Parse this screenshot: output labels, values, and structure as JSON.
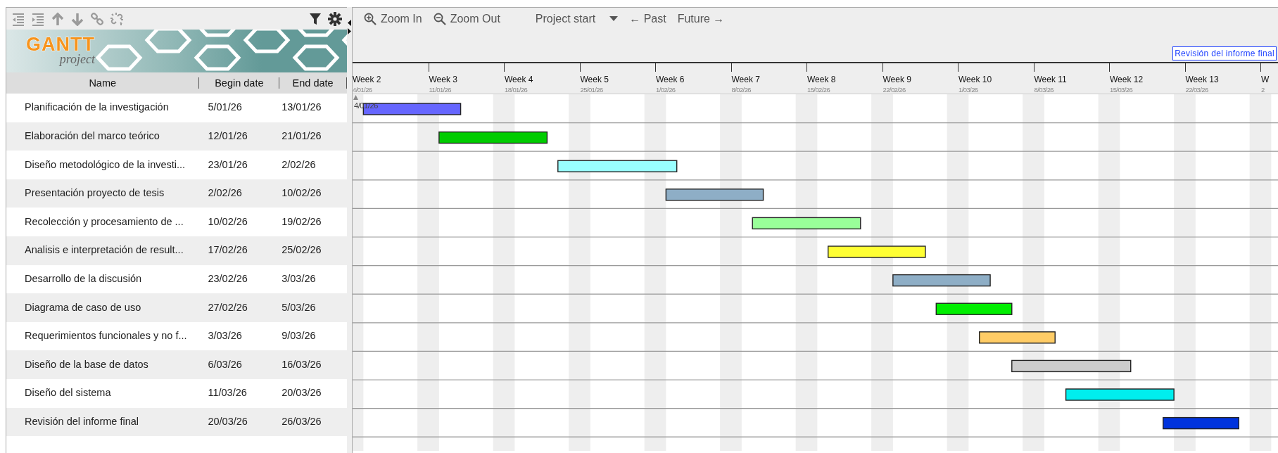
{
  "toolbar": {
    "buttons": [
      {
        "kind": "outdent",
        "disabled": true
      },
      {
        "kind": "indent",
        "disabled": true
      },
      {
        "kind": "up",
        "disabled": true
      },
      {
        "kind": "down",
        "disabled": true
      },
      {
        "kind": "link",
        "disabled": true
      },
      {
        "kind": "unlink",
        "disabled": true
      },
      {
        "kind": "filter",
        "disabled": false
      },
      {
        "kind": "settings",
        "disabled": false
      }
    ]
  },
  "logo": {
    "wordmark": "GANTT",
    "tagline": "project"
  },
  "columns": [
    "Name",
    "Begin date",
    "End date"
  ],
  "tasks": [
    {
      "name": "Planificación de la investigación",
      "begin": "5/01/26",
      "end": "13/01/26",
      "color": "#6666ff"
    },
    {
      "name": "Elaboración del marco teórico",
      "begin": "12/01/26",
      "end": "21/01/26",
      "color": "#00cc00"
    },
    {
      "name": "Diseño metodológico de la investi...",
      "begin": "23/01/26",
      "end": "2/02/26",
      "color": "#99ffff"
    },
    {
      "name": "Presentación proyecto de tesis",
      "begin": "2/02/26",
      "end": "10/02/26",
      "color": "#8eaec6"
    },
    {
      "name": "Recolección y procesamiento de ...",
      "begin": "10/02/26",
      "end": "19/02/26",
      "color": "#99ff99"
    },
    {
      "name": "Analisis e interpretación de result...",
      "begin": "17/02/26",
      "end": "25/02/26",
      "color": "#ffff33"
    },
    {
      "name": "Desarrollo de la discusión",
      "begin": "23/02/26",
      "end": "3/03/26",
      "color": "#8eaec6"
    },
    {
      "name": "Diagrama de caso de uso",
      "begin": "27/02/26",
      "end": "5/03/26",
      "color": "#00ee00"
    },
    {
      "name": "Requerimientos funcionales y no f...",
      "begin": "3/03/26",
      "end": "9/03/26",
      "color": "#ffcc66"
    },
    {
      "name": "Diseño de la base de datos",
      "begin": "6/03/26",
      "end": "16/03/26",
      "color": "#cccccc"
    },
    {
      "name": "Diseño del sistema",
      "begin": "11/03/26",
      "end": "20/03/26",
      "color": "#00eeee"
    },
    {
      "name": "Revisión del informe final",
      "begin": "20/03/26",
      "end": "26/03/26",
      "color": "#0033dd"
    }
  ],
  "timeline_toolbar": {
    "zoom_in": "Zoom In",
    "zoom_out": "Zoom Out",
    "project_start": "Project start",
    "past": "← Past",
    "future": "Future →"
  },
  "tooltip": "Revisión del informe final",
  "timescale": {
    "start_marker": "4/01/26",
    "weeks": [
      {
        "label": "Week 2",
        "date": "4/01/26"
      },
      {
        "label": "Week 3",
        "date": "11/01/26"
      },
      {
        "label": "Week 4",
        "date": "18/01/26"
      },
      {
        "label": "Week 5",
        "date": "25/01/26"
      },
      {
        "label": "Week 6",
        "date": "1/02/26"
      },
      {
        "label": "Week 7",
        "date": "8/02/26"
      },
      {
        "label": "Week 8",
        "date": "15/02/26"
      },
      {
        "label": "Week 9",
        "date": "22/02/26"
      },
      {
        "label": "Week 10",
        "date": "1/03/26"
      },
      {
        "label": "Week 11",
        "date": "8/03/26"
      },
      {
        "label": "Week 12",
        "date": "15/03/26"
      },
      {
        "label": "Week 13",
        "date": "22/03/26"
      },
      {
        "label": "W",
        "date": "2"
      }
    ]
  }
}
